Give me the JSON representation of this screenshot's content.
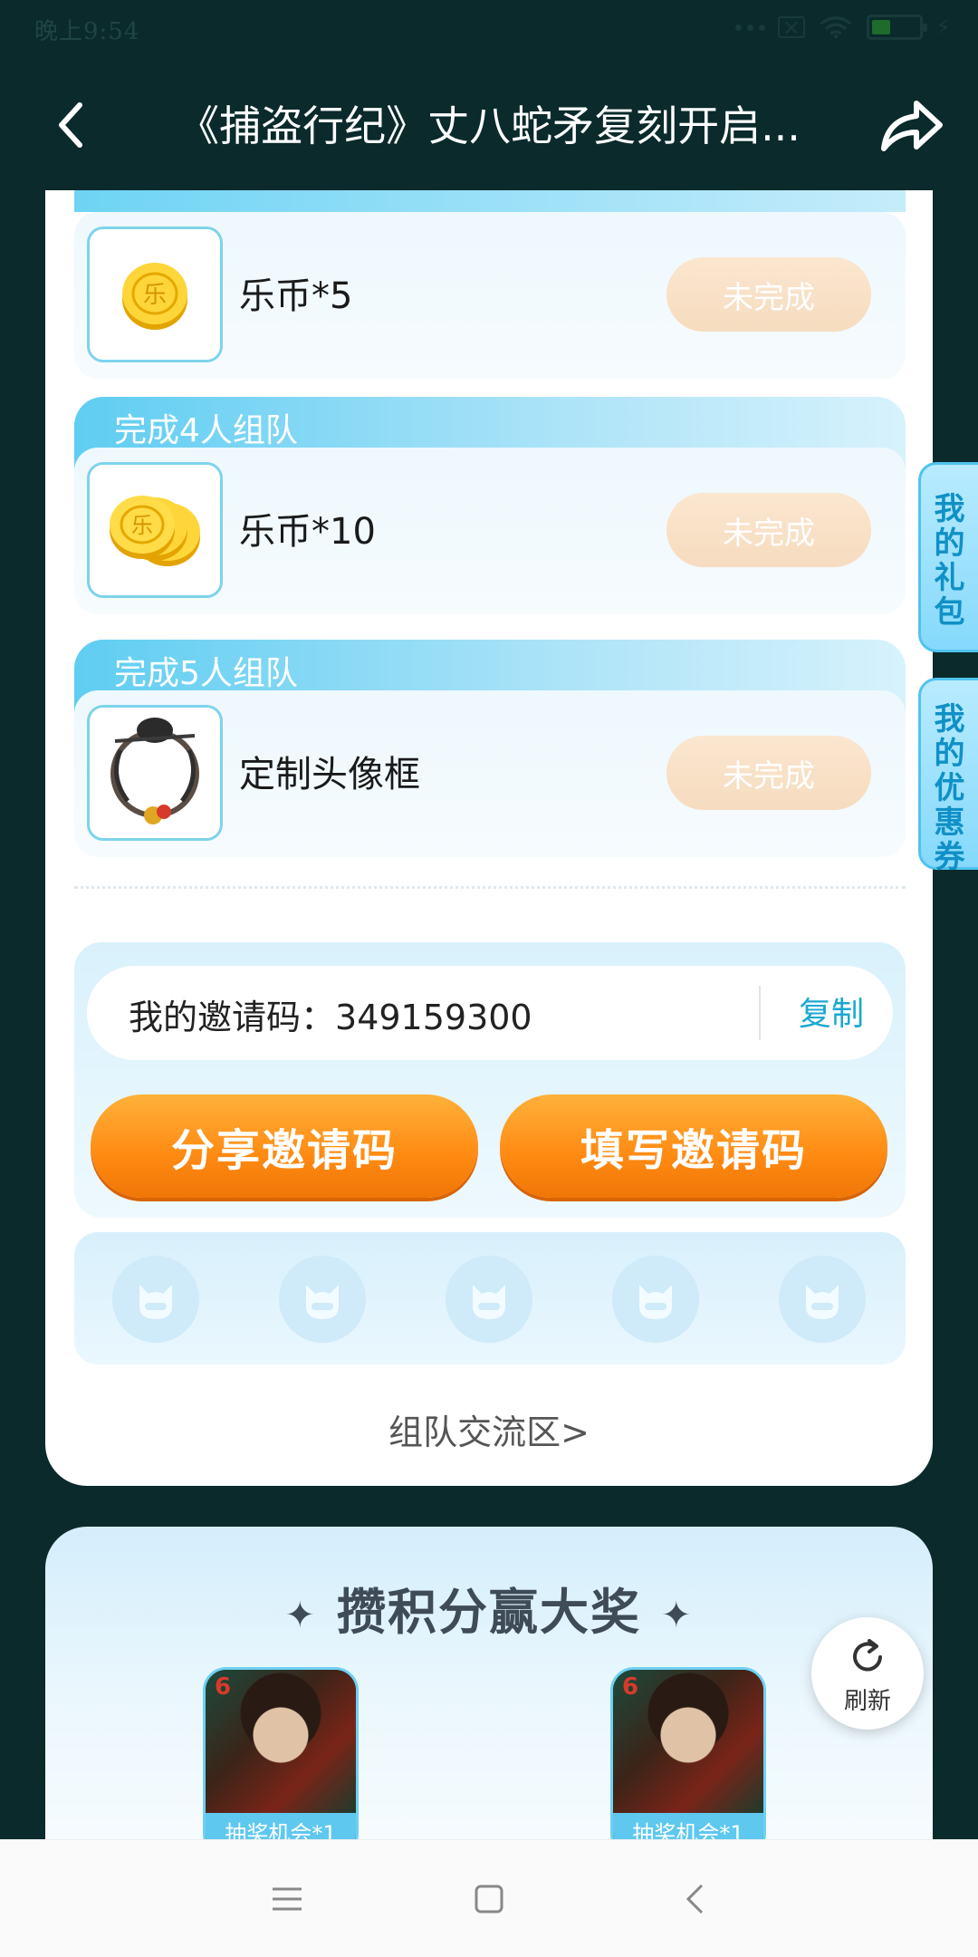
{
  "status_bar": {
    "time": "晚上9:54"
  },
  "header": {
    "title": "《捕盗行纪》丈八蛇矛复刻开启..."
  },
  "tasks": [
    {
      "tab_label": "完成4人组队",
      "reward": "乐币*10",
      "status": "未完成"
    },
    {
      "tab_label": "完成5人组队",
      "reward": "定制头像框",
      "status": "未完成"
    }
  ],
  "first_task": {
    "reward": "乐币*5",
    "status": "未完成"
  },
  "invite": {
    "label": "我的邀请码：",
    "code": "349159300",
    "copy_label": "复制",
    "share_button": "分享邀请码",
    "fill_button": "填写邀请码"
  },
  "team_link": "组队交流区>",
  "side_tabs": {
    "gift": "我的礼包",
    "coupon": "我的优惠券"
  },
  "points_section": {
    "title": "攒积分赢大奖",
    "prizes": [
      {
        "label": "抽奖机会*1",
        "badge": "6"
      },
      {
        "label": "抽奖机会*1",
        "badge": "6"
      }
    ]
  },
  "refresh_label": "刷新",
  "colors": {
    "accent_blue": "#5fcdf2",
    "orange": "#ff8a12",
    "header_bg": "#0a2a2b"
  }
}
